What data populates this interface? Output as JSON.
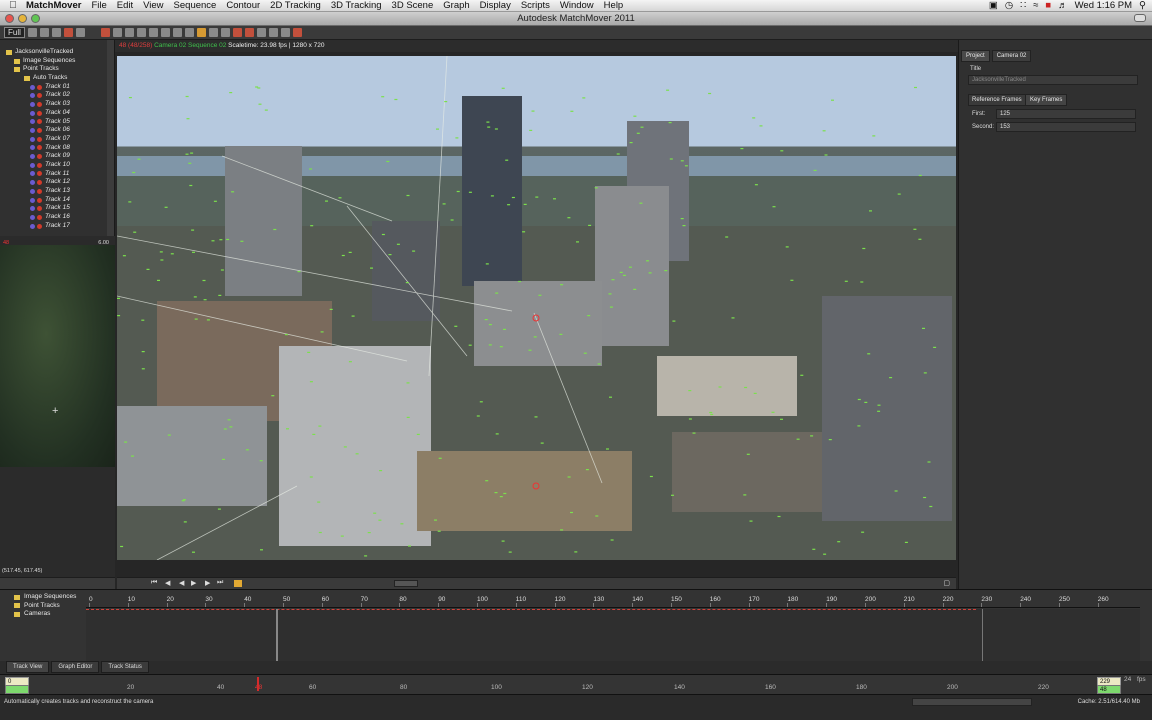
{
  "menubar": {
    "app_name": "MatchMover",
    "items": [
      "File",
      "Edit",
      "View",
      "Sequence",
      "Contour",
      "2D Tracking",
      "3D Tracking",
      "3D Scene",
      "Graph",
      "Display",
      "Window",
      "Scripts",
      "Help"
    ],
    "clock": "Wed 1:16 PM"
  },
  "window": {
    "title": "Autodesk MatchMover 2011"
  },
  "toolbar": {
    "dropdown_value": "Full"
  },
  "tree": {
    "project": "JacksonvilleTracked",
    "image_sequences": "Image Sequences",
    "point_tracks": "Point Tracks",
    "auto_tracks": "Auto Tracks",
    "tracks": [
      "Track 01",
      "Track 02",
      "Track 03",
      "Track 04",
      "Track 05",
      "Track 06",
      "Track 07",
      "Track 08",
      "Track 09",
      "Track 10",
      "Track 11",
      "Track 12",
      "Track 13",
      "Track 14",
      "Track 15",
      "Track 16",
      "Track 17"
    ]
  },
  "zoom": {
    "frame_label": "48",
    "value": "6.00",
    "coord": "(517.45, 617.45)"
  },
  "viewer": {
    "frame_info": "48 (48/258)",
    "camera": "Camera 02",
    "sequence": "Sequence 02",
    "details": "Scaletime: 23.98 fps | 1280 x 720"
  },
  "right_panel": {
    "tabs": [
      "Project",
      "Camera 02"
    ],
    "title_label": "Title",
    "title_value": "JacksonvilleTracked",
    "sub_tabs": [
      "Reference Frames",
      "Key Frames"
    ],
    "first_label": "First:",
    "first_value": "125",
    "second_label": "Second:",
    "second_value": "153"
  },
  "timeline": {
    "tree": [
      "Image Sequences",
      "Point Tracks",
      "Cameras"
    ],
    "ruler": [
      "0",
      "10",
      "20",
      "30",
      "40",
      "50",
      "60",
      "70",
      "80",
      "90",
      "100",
      "110",
      "120",
      "130",
      "140",
      "150",
      "160",
      "170",
      "180",
      "190",
      "200",
      "210",
      "220",
      "230",
      "240",
      "250",
      "260"
    ],
    "tabs": [
      "Track View",
      "Graph Editor",
      "Track Status"
    ]
  },
  "scrubber": {
    "start": "0",
    "end": "229",
    "cur": "48",
    "fps_value": "24",
    "fps_label": "fps",
    "ticks": [
      "20",
      "40",
      "48",
      "60",
      "80",
      "100",
      "120",
      "140",
      "160",
      "180",
      "200",
      "220"
    ]
  },
  "status": {
    "message": "Automatically creates tracks and reconstruct the camera",
    "cache": "Cache: 2.51/614.40 Mb"
  },
  "colors": {
    "accent_red": "#e03e3e",
    "track_green": "#3fc04c",
    "folder": "#e2c34a"
  }
}
